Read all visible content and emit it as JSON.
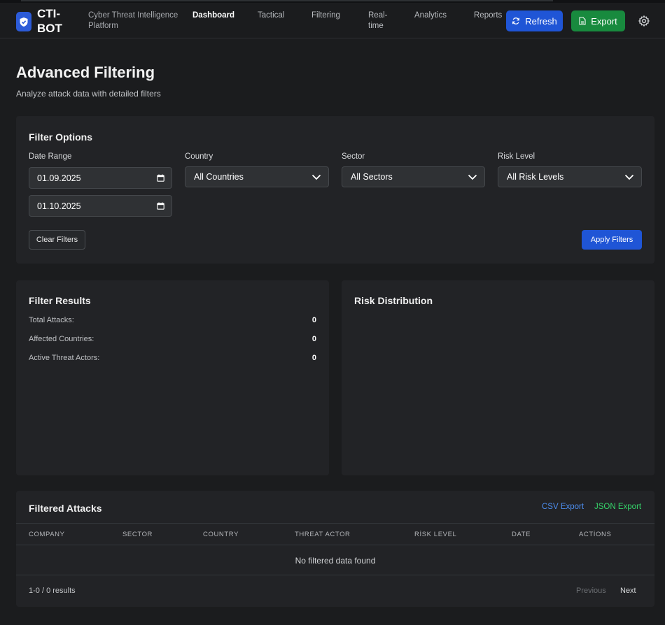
{
  "header": {
    "brand": "CTI-BOT",
    "subtitle": "Cyber Threat Intelligence Platform",
    "nav": [
      {
        "label": "Dashboard",
        "active": true
      },
      {
        "label": "Tactical",
        "active": false
      },
      {
        "label": "Filtering",
        "active": false
      },
      {
        "label": "Real-time",
        "active": false
      },
      {
        "label": "Analytics",
        "active": false
      },
      {
        "label": "Reports",
        "active": false
      }
    ],
    "refresh_label": "Refresh",
    "export_label": "Export"
  },
  "page": {
    "title": "Advanced Filtering",
    "subtitle": "Analyze attack data with detailed filters"
  },
  "filters": {
    "title": "Filter Options",
    "date_range_label": "Date Range",
    "date_from": "01.09.2025",
    "date_to": "01.10.2025",
    "country_label": "Country",
    "country_value": "All Countries",
    "sector_label": "Sector",
    "sector_value": "All Sectors",
    "risk_label": "Risk Level",
    "risk_value": "All Risk Levels",
    "clear_label": "Clear Filters",
    "apply_label": "Apply Filters"
  },
  "results": {
    "title": "Filter Results",
    "stats": [
      {
        "label": "Total Attacks:",
        "value": "0"
      },
      {
        "label": "Affected Countries:",
        "value": "0"
      },
      {
        "label": "Active Threat Actors:",
        "value": "0"
      }
    ]
  },
  "risk": {
    "title": "Risk Distribution"
  },
  "attacks": {
    "title": "Filtered Attacks",
    "csv_label": "CSV Export",
    "json_label": "JSON Export",
    "columns": [
      "COMPANY",
      "SECTOR",
      "COUNTRY",
      "THREAT ACTOR",
      "RİSK LEVEL",
      "DATE",
      "ACTİONS"
    ],
    "empty": "No filtered data found",
    "summary": "1-0 / 0 results",
    "prev_label": "Previous",
    "next_label": "Next"
  },
  "colors": {
    "primary": "#1f55d6",
    "success": "#188a3e",
    "csv_link": "#4d8ef0",
    "json_link": "#35d46a",
    "background": "#1b1c1e",
    "card": "#222326"
  }
}
